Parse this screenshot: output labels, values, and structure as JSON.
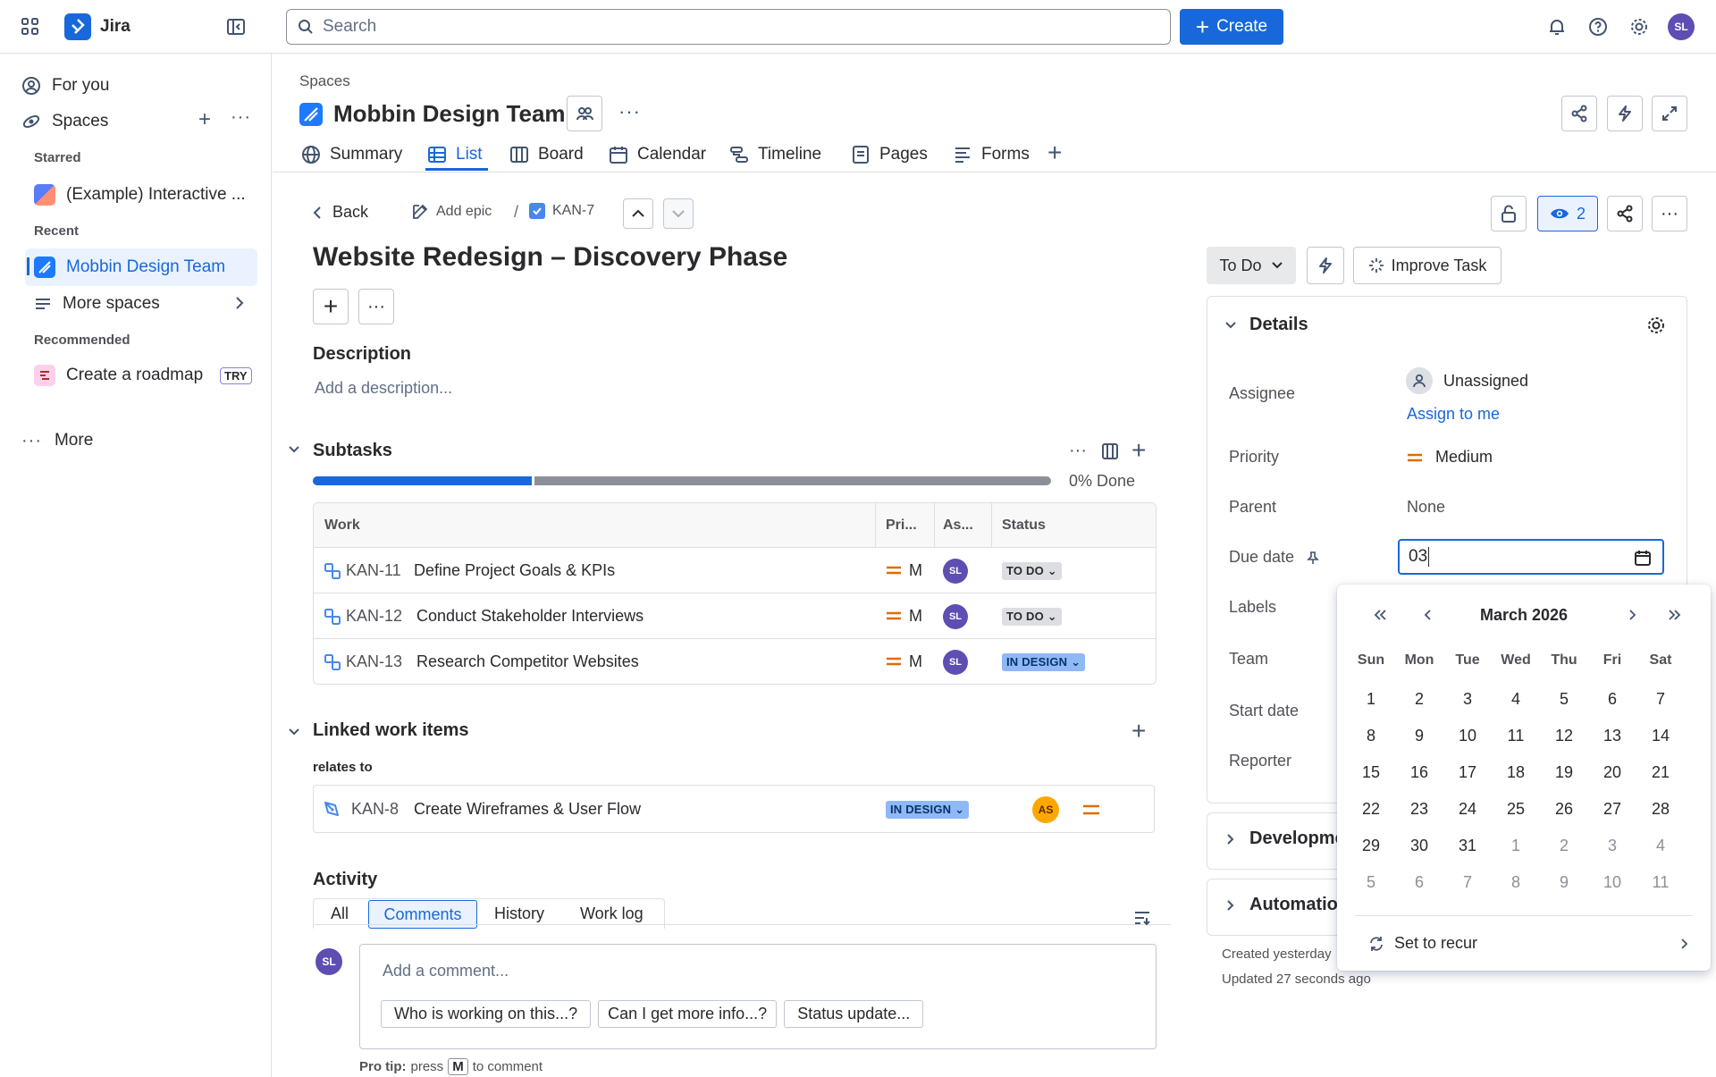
{
  "app": {
    "name": "Jira"
  },
  "topbar": {
    "search_placeholder": "Search",
    "create_label": "Create",
    "user_initials": "SL"
  },
  "sidebar": {
    "for_you": "For you",
    "spaces": "Spaces",
    "starred_heading": "Starred",
    "starred_item": "(Example) Interactive ...",
    "recent_heading": "Recent",
    "recent_item": "Mobbin Design Team",
    "more_spaces": "More spaces",
    "recommended_heading": "Recommended",
    "recommended_item": "Create a roadmap",
    "try_badge": "TRY",
    "more": "More"
  },
  "space": {
    "breadcrumb": "Spaces",
    "title": "Mobbin Design Team",
    "tabs": [
      "Summary",
      "List",
      "Board",
      "Calendar",
      "Timeline",
      "Pages",
      "Forms"
    ],
    "active_tab": "List"
  },
  "issue": {
    "back": "Back",
    "add_epic": "Add epic",
    "separator": "/",
    "key": "KAN-7",
    "title": "Website Redesign – Discovery Phase",
    "description_heading": "Description",
    "description_placeholder": "Add a description...",
    "subtasks_heading": "Subtasks",
    "progress_label": "0% Done",
    "progress_fraction": 0.3,
    "subtask_columns": [
      "Work",
      "Pri...",
      "As...",
      "Status"
    ],
    "subtasks": [
      {
        "key": "KAN-11",
        "summary": "Define Project Goals & KPIs",
        "priority": "M",
        "assignee": "SL",
        "status": "TO DO"
      },
      {
        "key": "KAN-12",
        "summary": "Conduct Stakeholder Interviews",
        "priority": "M",
        "assignee": "SL",
        "status": "TO DO"
      },
      {
        "key": "KAN-13",
        "summary": "Research Competitor Websites",
        "priority": "M",
        "assignee": "SL",
        "status": "IN DESIGN"
      }
    ],
    "linked_heading": "Linked work items",
    "relates_to": "relates to",
    "linked": {
      "key": "KAN-8",
      "summary": "Create Wireframes & User Flow",
      "status": "IN DESIGN",
      "assignee": "AS"
    },
    "activity_heading": "Activity",
    "activity_tabs": [
      "All",
      "Comments",
      "History",
      "Work log"
    ],
    "activity_active": "Comments",
    "comment_placeholder": "Add a comment...",
    "quick_replies": [
      "Who is working on this...?",
      "Can I get more info...?",
      "Status update..."
    ],
    "pro_tip_prefix": "Pro tip:",
    "pro_tip_press": "press",
    "pro_tip_key": "M",
    "pro_tip_suffix": "to comment"
  },
  "right_panel": {
    "watch_count": "2",
    "status": "To Do",
    "improve_task": "Improve Task",
    "details_heading": "Details",
    "assignee_label": "Assignee",
    "assignee_value": "Unassigned",
    "assign_to_me": "Assign to me",
    "priority_label": "Priority",
    "priority_value": "Medium",
    "parent_label": "Parent",
    "parent_value": "None",
    "due_label": "Due date",
    "due_input": "03",
    "labels_label": "Labels",
    "team_label": "Team",
    "start_label": "Start date",
    "reporter_label": "Reporter",
    "development": "Developme",
    "automation": "Automatio",
    "created": "Created yesterday",
    "updated": "Updated 27 seconds ago"
  },
  "calendar": {
    "month": "March 2026",
    "days_of_week": [
      "Sun",
      "Mon",
      "Tue",
      "Wed",
      "Thu",
      "Fri",
      "Sat"
    ],
    "weeks": [
      [
        "1",
        "2",
        "3",
        "4",
        "5",
        "6",
        "7"
      ],
      [
        "8",
        "9",
        "10",
        "11",
        "12",
        "13",
        "14"
      ],
      [
        "15",
        "16",
        "17",
        "18",
        "19",
        "20",
        "21"
      ],
      [
        "22",
        "23",
        "24",
        "25",
        "26",
        "27",
        "28"
      ],
      [
        "29",
        "30",
        "31",
        "1",
        "2",
        "3",
        "4"
      ],
      [
        "5",
        "6",
        "7",
        "8",
        "9",
        "10",
        "11"
      ]
    ],
    "set_to_recur": "Set to recur"
  }
}
